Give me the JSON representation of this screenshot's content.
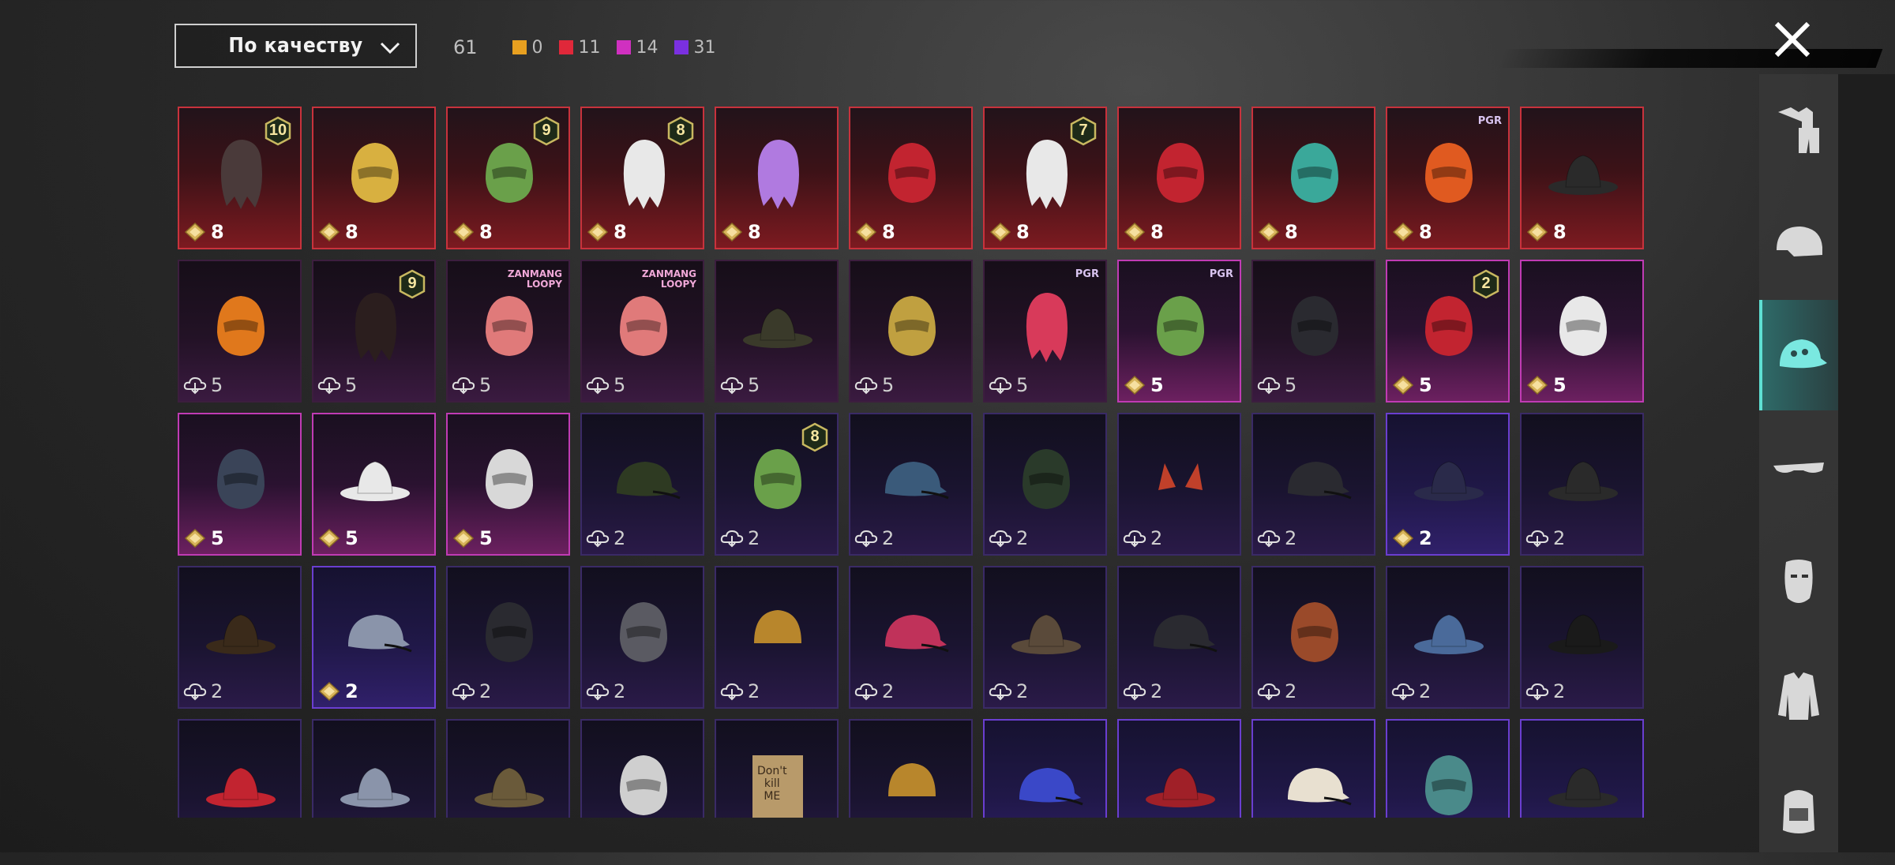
{
  "header": {
    "sort_label": "По качеству",
    "total_count": "61",
    "quality_counts": [
      {
        "color": "#e8a020",
        "value": "0"
      },
      {
        "color": "#e0283a",
        "value": "11"
      },
      {
        "color": "#d030c0",
        "value": "14"
      },
      {
        "color": "#7a30e0",
        "value": "31"
      }
    ]
  },
  "sidebar": {
    "categories": [
      {
        "name": "outfit-icon",
        "active": false
      },
      {
        "name": "helmet-icon",
        "active": false
      },
      {
        "name": "cap-icon",
        "active": true
      },
      {
        "name": "glasses-icon",
        "active": false
      },
      {
        "name": "mask-icon",
        "active": false
      },
      {
        "name": "jacket-icon",
        "active": false
      },
      {
        "name": "backpack-icon",
        "active": false
      }
    ]
  },
  "items": [
    {
      "r": "legendary",
      "icon": "braided-hair-icon",
      "cost": "8",
      "cur": "gem",
      "lvl": "10"
    },
    {
      "r": "legendary",
      "icon": "masked-blonde-hair-icon",
      "cost": "8",
      "cur": "gem"
    },
    {
      "r": "legendary",
      "icon": "green-zombie-head-icon",
      "cost": "8",
      "cur": "gem",
      "lvl": "9"
    },
    {
      "r": "legendary",
      "icon": "white-feather-hair-icon",
      "cost": "8",
      "cur": "gem",
      "lvl": "8"
    },
    {
      "r": "legendary",
      "icon": "purple-jellyfish-hair-icon",
      "cost": "8",
      "cur": "gem"
    },
    {
      "r": "legendary",
      "icon": "red-demon-mask-icon",
      "cost": "8",
      "cur": "gem"
    },
    {
      "r": "legendary",
      "icon": "white-long-hair-icon",
      "cost": "8",
      "cur": "gem",
      "lvl": "7"
    },
    {
      "r": "legendary",
      "icon": "red-helmet-icon",
      "cost": "8",
      "cur": "gem"
    },
    {
      "r": "legendary",
      "icon": "teal-dragon-helmet-icon",
      "cost": "8",
      "cur": "gem"
    },
    {
      "r": "legendary",
      "icon": "mecha-helmet-icon",
      "cost": "8",
      "cur": "gem",
      "brand": "PGR"
    },
    {
      "r": "legendary",
      "icon": "pirate-hat-icon",
      "cost": "8",
      "cur": "gem"
    },
    {
      "r": "epic-dark",
      "icon": "pumpkin-head-icon",
      "cost": "5",
      "cur": "cloud"
    },
    {
      "r": "epic-dark",
      "icon": "dark-long-hair-icon",
      "cost": "5",
      "cur": "cloud",
      "lvl": "9"
    },
    {
      "r": "epic-dark",
      "icon": "loopy-beaver-head-icon",
      "cost": "5",
      "cur": "cloud",
      "brand": "ZANMANG\nLOOPY",
      "brandPink": true
    },
    {
      "r": "epic-dark",
      "icon": "loopy-beaver-head-icon",
      "cost": "5",
      "cur": "cloud",
      "brand": "ZANMANG\nLOOPY",
      "brandPink": true
    },
    {
      "r": "epic-dark",
      "icon": "wide-brim-hat-icon",
      "cost": "5",
      "cur": "cloud"
    },
    {
      "r": "epic-dark",
      "icon": "feather-headdress-icon",
      "cost": "5",
      "cur": "cloud"
    },
    {
      "r": "epic-dark",
      "icon": "pink-hair-icon",
      "cost": "5",
      "cur": "cloud",
      "brand": "PGR"
    },
    {
      "r": "epic",
      "icon": "green-octopus-head-icon",
      "cost": "5",
      "cur": "gem",
      "brand": "PGR"
    },
    {
      "r": "epic-dark",
      "icon": "black-racing-helmet-icon",
      "cost": "5",
      "cur": "cloud"
    },
    {
      "r": "epic",
      "icon": "predator-mask-icon",
      "cost": "5",
      "cur": "gem",
      "lvl": "2"
    },
    {
      "r": "epic",
      "icon": "fox-helmet-icon",
      "cost": "5",
      "cur": "gem"
    },
    {
      "r": "epic",
      "icon": "visor-helmet-icon",
      "cost": "5",
      "cur": "gem"
    },
    {
      "r": "epic",
      "icon": "white-sun-hat-icon",
      "cost": "5",
      "cur": "gem"
    },
    {
      "r": "epic",
      "icon": "chicken-head-icon",
      "cost": "5",
      "cur": "gem"
    },
    {
      "r": "rare",
      "icon": "military-cap-icon",
      "cost": "2",
      "cur": "cloud"
    },
    {
      "r": "rare",
      "icon": "green-skull-hood-icon",
      "cost": "2",
      "cur": "cloud",
      "lvl": "8"
    },
    {
      "r": "rare",
      "icon": "baseball-cap-icon",
      "cost": "2",
      "cur": "cloud"
    },
    {
      "r": "rare",
      "icon": "gas-mask-helmet-icon",
      "cost": "2",
      "cur": "cloud"
    },
    {
      "r": "rare",
      "icon": "cat-ears-icon",
      "cost": "2",
      "cur": "cloud"
    },
    {
      "r": "rare",
      "icon": "black-mesh-cap-icon",
      "cost": "2",
      "cur": "cloud"
    },
    {
      "r": "rare-lit",
      "icon": "witch-hat-icon",
      "cost": "2",
      "cur": "gem"
    },
    {
      "r": "rare",
      "icon": "sombrero-icon",
      "cost": "2",
      "cur": "cloud"
    },
    {
      "r": "rare",
      "icon": "steampunk-hat-icon",
      "cost": "2",
      "cur": "cloud"
    },
    {
      "r": "rare-lit",
      "icon": "grey-cap-icon",
      "cost": "2",
      "cur": "gem"
    },
    {
      "r": "rare",
      "icon": "black-gas-mask-icon",
      "cost": "2",
      "cur": "cloud"
    },
    {
      "r": "rare",
      "icon": "goggles-helmet-icon",
      "cost": "2",
      "cur": "cloud"
    },
    {
      "r": "rare",
      "icon": "beanie-icon",
      "cost": "2",
      "cur": "cloud"
    },
    {
      "r": "rare",
      "icon": "beret-icon",
      "cost": "2",
      "cur": "cloud"
    },
    {
      "r": "rare",
      "icon": "aviator-hat-icon",
      "cost": "2",
      "cur": "cloud"
    },
    {
      "r": "rare",
      "icon": "black-cap-icon",
      "cost": "2",
      "cur": "cloud"
    },
    {
      "r": "rare",
      "icon": "football-helmet-icon",
      "cost": "2",
      "cur": "cloud"
    },
    {
      "r": "rare",
      "icon": "shark-hat-icon",
      "cost": "2",
      "cur": "cloud"
    },
    {
      "r": "rare",
      "icon": "top-hat-icon",
      "cost": "2",
      "cur": "cloud"
    },
    {
      "r": "rare",
      "icon": "red-fedora-icon"
    },
    {
      "r": "rare",
      "icon": "grey-shark-hat-icon"
    },
    {
      "r": "rare",
      "icon": "knit-monster-hat-icon"
    },
    {
      "r": "rare",
      "icon": "doctor-headband-icon"
    },
    {
      "r": "rare",
      "icon": "cardboard-box-icon",
      "boxText": "Don't\nkill\nME"
    },
    {
      "r": "rare",
      "icon": "navy-beanie-icon"
    },
    {
      "r": "rare-lit",
      "icon": "blue-trucker-cap-icon"
    },
    {
      "r": "rare-lit",
      "icon": "maroon-fedora-icon"
    },
    {
      "r": "rare-lit",
      "icon": "officer-cap-icon"
    },
    {
      "r": "rare-lit",
      "icon": "pattern-helmet-icon"
    },
    {
      "r": "rare-lit",
      "icon": "bucket-hat-icon"
    }
  ]
}
